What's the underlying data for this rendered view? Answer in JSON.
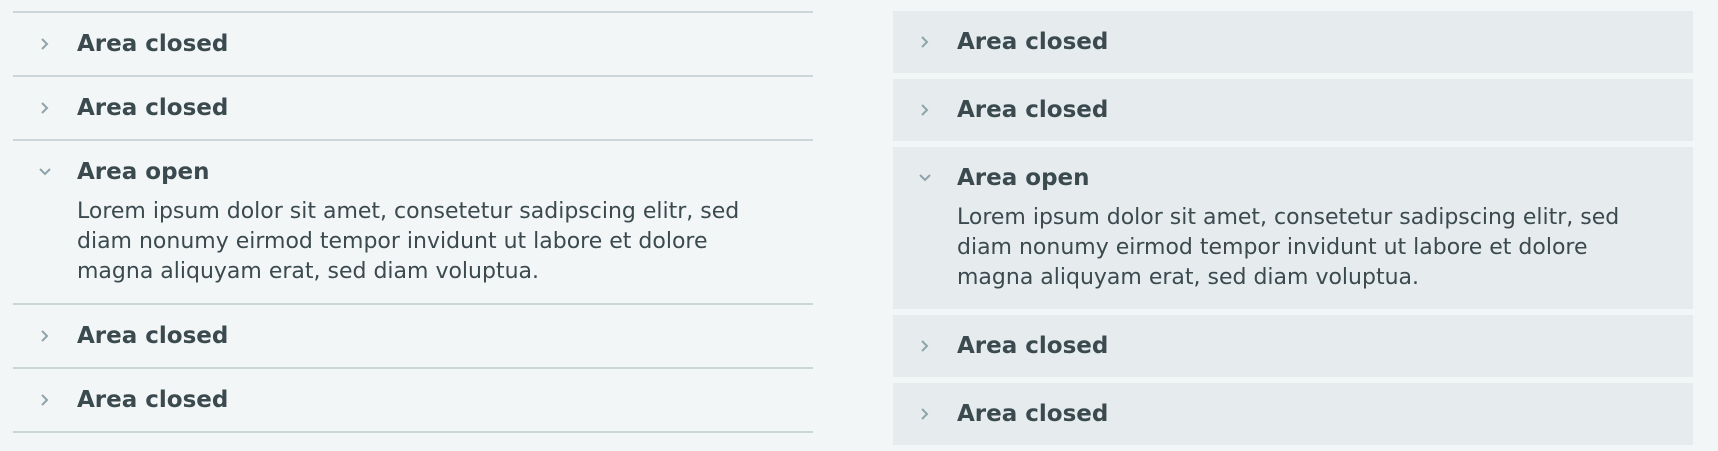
{
  "left_accordion": {
    "items": [
      {
        "title": "Area closed",
        "open": false,
        "content": ""
      },
      {
        "title": "Area closed",
        "open": false,
        "content": ""
      },
      {
        "title": "Area open",
        "open": true,
        "content": "Lorem ipsum dolor sit amet, consetetur sadipscing elitr, sed diam nonumy eirmod tempor invidunt ut labore et dolore magna aliquyam erat, sed diam voluptua."
      },
      {
        "title": "Area closed",
        "open": false,
        "content": ""
      },
      {
        "title": "Area closed",
        "open": false,
        "content": ""
      }
    ]
  },
  "right_accordion": {
    "items": [
      {
        "title": "Area closed",
        "open": false,
        "content": ""
      },
      {
        "title": "Area closed",
        "open": false,
        "content": ""
      },
      {
        "title": "Area open",
        "open": true,
        "content": "Lorem ipsum dolor sit amet, consetetur sadipscing elitr, sed diam nonumy eirmod tempor invidunt ut labore et dolore magna aliquyam erat, sed diam voluptua."
      },
      {
        "title": "Area closed",
        "open": false,
        "content": ""
      },
      {
        "title": "Area closed",
        "open": false,
        "content": ""
      }
    ]
  },
  "icons": {
    "closed": "chevron-right-icon",
    "open": "chevron-down-icon"
  },
  "colors": {
    "background": "#f2f6f7",
    "panel_fill": "#e6ecee",
    "divider": "#ccd5d8",
    "chevron": "#8fa3aa",
    "text": "#3b4a4f"
  }
}
